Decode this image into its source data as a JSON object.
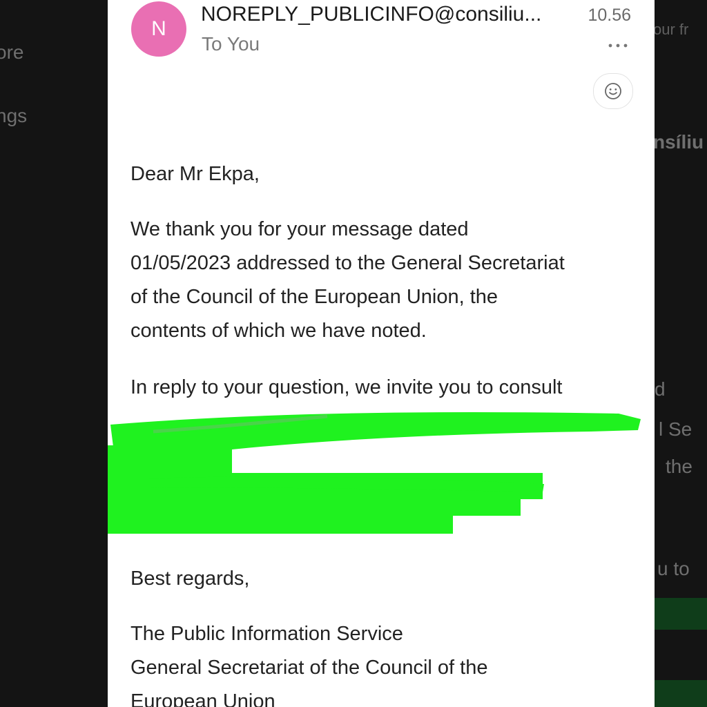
{
  "background": {
    "left_fragments": [
      "ore",
      "ngs"
    ],
    "right_fragments": [
      "our fr",
      "nsíliu",
      "d",
      "l Se",
      "the",
      "u to"
    ]
  },
  "email": {
    "avatar_letter": "N",
    "sender": "NOREPLY_PUBLICINFO@consiliu...",
    "time": "10.56",
    "recipient": "To You",
    "more_icon": "more-icon",
    "reaction_icon": "emoji-icon",
    "greeting": "Dear Mr Ekpa,",
    "paragraph1": [
      "We thank you for your message dated",
      "01/05/2023 addressed to the General Secretariat",
      "of the Council of the European Union, the",
      "contents of which we have noted."
    ],
    "paragraph2_visible": "In reply to your question, we invite you to consult",
    "redaction_color": "#1ff21f",
    "closing": "Best regards,",
    "signature": [
      "The Public Information Service",
      "General Secretariat of the Council of the",
      "European Union"
    ]
  }
}
